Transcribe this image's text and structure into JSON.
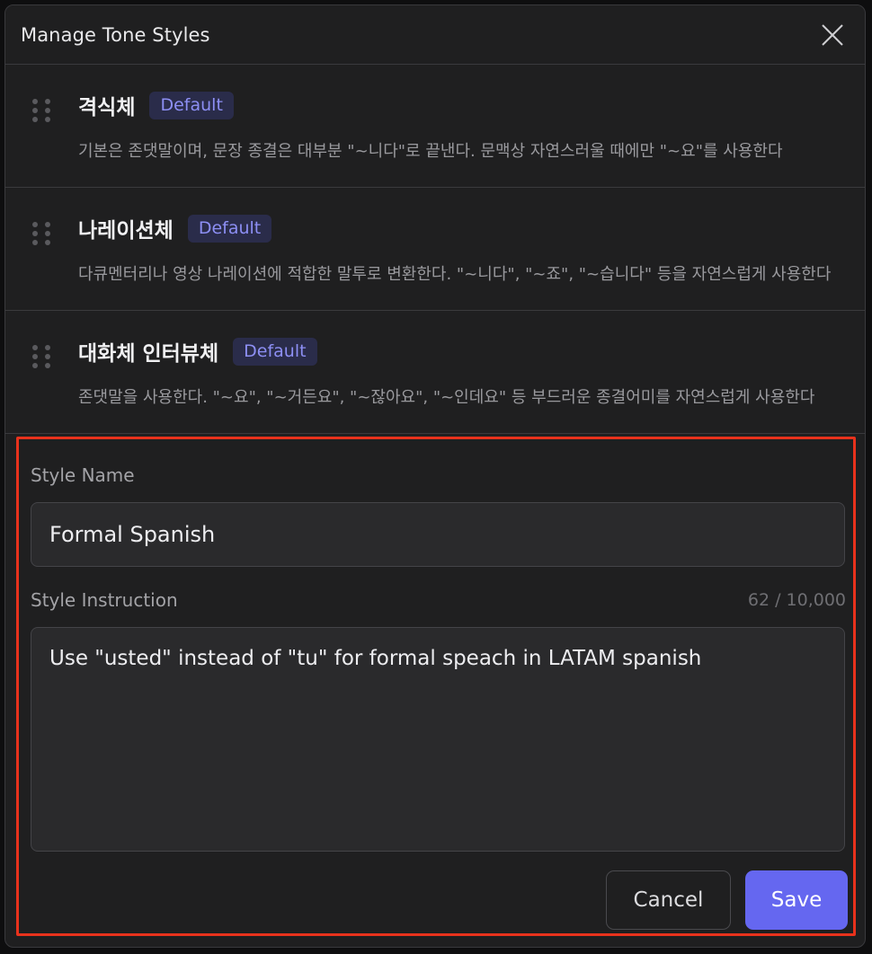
{
  "modal": {
    "title": "Manage Tone Styles",
    "close_icon": "close-icon"
  },
  "styles": [
    {
      "name": "격식체",
      "badge": "Default",
      "description": "기본은 존댓말이며, 문장 종결은 대부분 \"~니다\"로 끝낸다. 문맥상 자연스러울 때에만 \"~요\"를 사용한다"
    },
    {
      "name": "나레이션체",
      "badge": "Default",
      "description": "다큐멘터리나 영상 나레이션에 적합한 말투로 변환한다. \"~니다\", \"~죠\", \"~습니다\" 등을 자연스럽게 사용한다"
    },
    {
      "name": "대화체 인터뷰체",
      "badge": "Default",
      "description": "존댓말을 사용한다. \"~요\", \"~거든요\", \"~잖아요\", \"~인데요\" 등 부드러운 종결어미를 자연스럽게 사용한다"
    }
  ],
  "form": {
    "style_name_label": "Style Name",
    "style_name_value": "Formal Spanish",
    "style_instruction_label": "Style Instruction",
    "char_counter": "62 / 10,000",
    "style_instruction_value": "Use \"usted\" instead of \"tu\" for formal speach in LATAM spanish",
    "cancel_label": "Cancel",
    "save_label": "Save"
  },
  "colors": {
    "accent": "#6567f0",
    "highlight_border": "#e8321c",
    "badge_bg": "#2a2c4a",
    "badge_text": "#8d8ff4"
  }
}
